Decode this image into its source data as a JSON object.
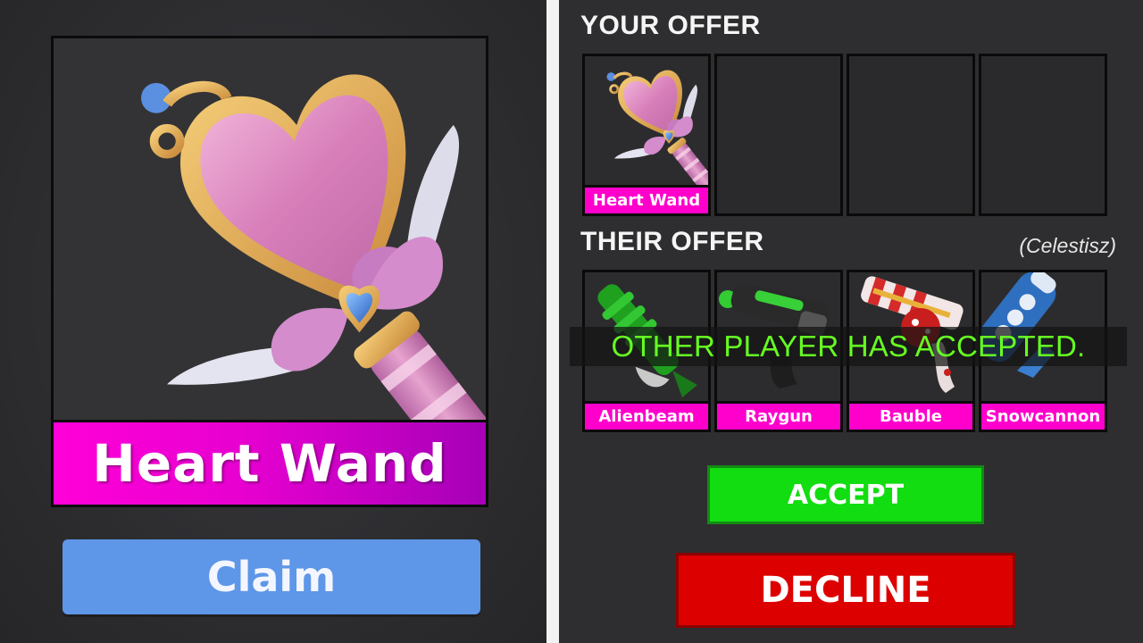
{
  "colors": {
    "rarity_magenta": "#ff00cc",
    "rarity_purple": "#b400c8",
    "claim_blue": "#5e96e8",
    "accept_green": "#11dd11",
    "decline_red": "#dd0000",
    "banner_text_green": "#66ff22"
  },
  "showcase": {
    "item_name": "Heart Wand",
    "item_icon": "heart-wand-icon",
    "claim_label": "Claim"
  },
  "trade": {
    "your_offer_title": "YOUR OFFER",
    "their_offer_title": "THEIR OFFER",
    "partner_name": "(Celestisz)",
    "your_offer": [
      {
        "label": "Heart Wand",
        "icon": "heart-wand-icon"
      },
      {
        "label": "",
        "icon": ""
      },
      {
        "label": "",
        "icon": ""
      },
      {
        "label": "",
        "icon": ""
      }
    ],
    "their_offer": [
      {
        "label": "Alienbeam",
        "icon": "alienbeam-icon"
      },
      {
        "label": "Raygun",
        "icon": "raygun-icon"
      },
      {
        "label": "Bauble",
        "icon": "bauble-icon"
      },
      {
        "label": "Snowcannon",
        "icon": "snowcannon-icon"
      }
    ],
    "status_message": "OTHER PLAYER HAS ACCEPTED.",
    "accept_label": "ACCEPT",
    "decline_label": "DECLINE"
  }
}
